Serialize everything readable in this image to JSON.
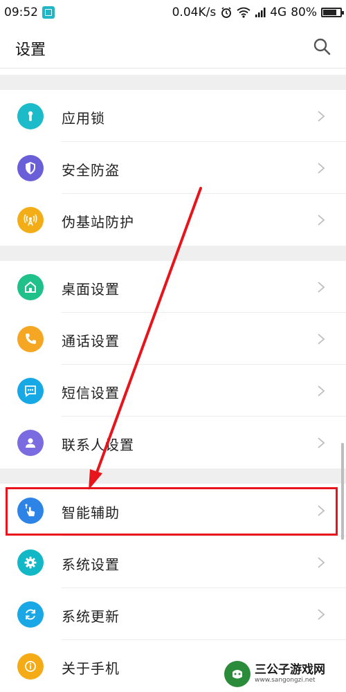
{
  "status_bar": {
    "time": "09:52",
    "net_speed": "0.04K/s",
    "network": "4G",
    "battery": "80%",
    "battery_level": 0.8
  },
  "app_bar": {
    "title": "设置",
    "search_icon": "search-icon"
  },
  "settings": {
    "items": [
      {
        "label": "应用锁",
        "icon": "keyhole-icon",
        "color": "#1bbbc9"
      },
      {
        "label": "安全防盗",
        "icon": "shield-icon",
        "color": "#6a5fd9"
      },
      {
        "label": "伪基站防护",
        "icon": "antenna-icon",
        "color": "#f3ad17"
      },
      {
        "label": "桌面设置",
        "icon": "home-icon",
        "color": "#20c08a"
      },
      {
        "label": "通话设置",
        "icon": "phone-icon",
        "color": "#f5a623"
      },
      {
        "label": "短信设置",
        "icon": "message-icon",
        "color": "#17a8e6"
      },
      {
        "label": "联系人设置",
        "icon": "contact-icon",
        "color": "#7a6ce0"
      },
      {
        "label": "智能辅助",
        "icon": "touch-icon",
        "color": "#2d84e6"
      },
      {
        "label": "系统设置",
        "icon": "gear-icon",
        "color": "#12b8c6"
      },
      {
        "label": "系统更新",
        "icon": "refresh-icon",
        "color": "#1aa7e6"
      },
      {
        "label": "关于手机",
        "icon": "info-icon",
        "color": "#f4ab16"
      }
    ]
  },
  "colors": {
    "highlight": "#e8141b",
    "divider_band": "#efefef"
  },
  "watermark": {
    "text": "三公子游戏网",
    "url": "www.sangongzi.net"
  }
}
